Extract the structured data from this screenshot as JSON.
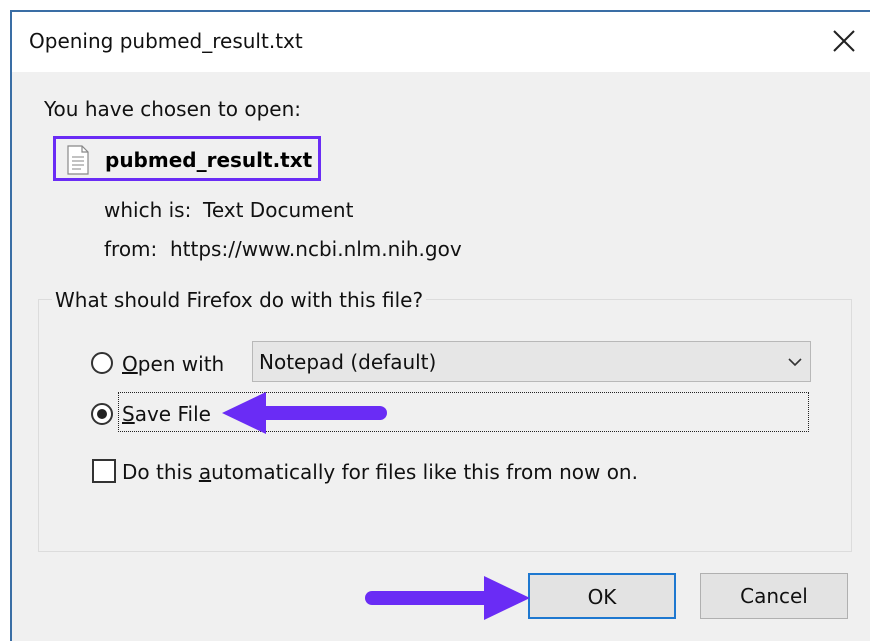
{
  "window": {
    "title": "Opening pubmed_result.txt",
    "close_glyph": "✕"
  },
  "prompt": "You have chosen to open:",
  "file": {
    "name": "pubmed_result.txt",
    "type_label": "which is:",
    "type_value": "Text Document",
    "from_label": "from:",
    "from_value": "https://www.ncbi.nlm.nih.gov"
  },
  "question": "What should Firefox do with this file?",
  "options": {
    "open_with_prefix": "O",
    "open_with_rest": "pen with",
    "open_with_app": "Notepad (default)",
    "save_file_prefix": "S",
    "save_file_rest": "ave File",
    "auto_before": "Do this ",
    "auto_underlined": "a",
    "auto_after": "utomatically for files like this from now on."
  },
  "state": {
    "selected_option": "save_file",
    "auto_checked": false
  },
  "buttons": {
    "ok": "OK",
    "cancel": "Cancel"
  },
  "annotation_color": "#6a2cf5",
  "icons": {
    "close": "close-icon",
    "file": "text-file-icon",
    "dropdown": "chevron-down-icon",
    "arrow_left": "arrow-left-icon",
    "arrow_right": "arrow-right-icon"
  }
}
